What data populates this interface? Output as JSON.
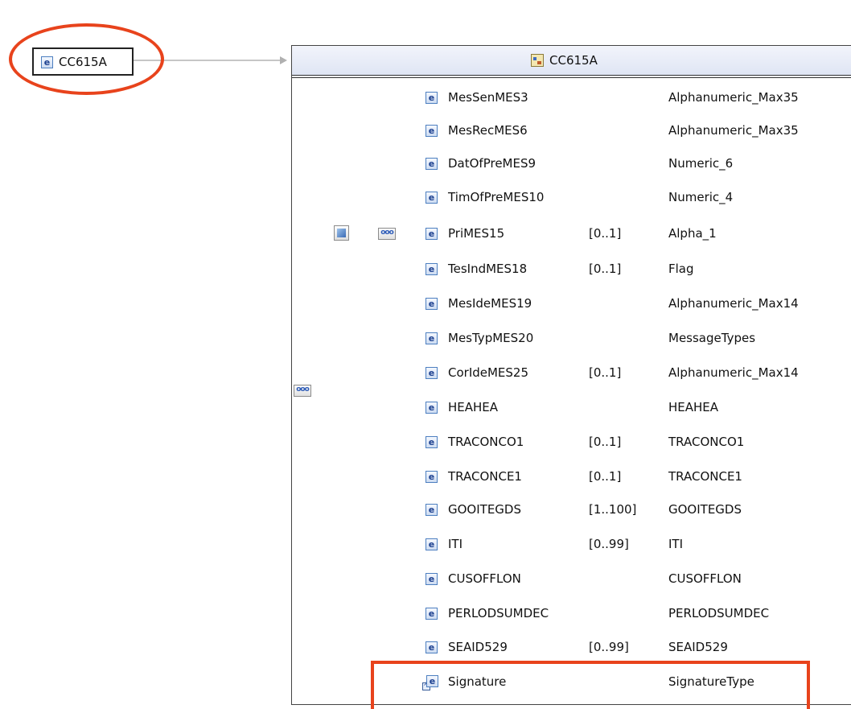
{
  "root": {
    "label": "CC615A",
    "icon": "element-icon"
  },
  "complex_type": {
    "title": "CC615A",
    "icon": "complex-type-icon"
  },
  "sequence_icon_text": "ooo",
  "header_elements": [
    {
      "name": "MesSenMES3",
      "cardinality": "",
      "type": "Alphanumeric_Max35"
    },
    {
      "name": "MesRecMES6",
      "cardinality": "",
      "type": "Alphanumeric_Max35"
    },
    {
      "name": "DatOfPreMES9",
      "cardinality": "",
      "type": "Numeric_6"
    },
    {
      "name": "TimOfPreMES10",
      "cardinality": "",
      "type": "Numeric_4"
    },
    {
      "name": "PriMES15",
      "cardinality": "[0..1]",
      "type": "Alpha_1"
    },
    {
      "name": "TesIndMES18",
      "cardinality": "[0..1]",
      "type": "Flag"
    },
    {
      "name": "MesIdeMES19",
      "cardinality": "",
      "type": "Alphanumeric_Max14"
    },
    {
      "name": "MesTypMES20",
      "cardinality": "",
      "type": "MessageTypes"
    },
    {
      "name": "CorIdeMES25",
      "cardinality": "[0..1]",
      "type": "Alphanumeric_Max14"
    }
  ],
  "body_elements": [
    {
      "name": "HEAHEA",
      "cardinality": "",
      "type": "HEAHEA"
    },
    {
      "name": "TRACONCO1",
      "cardinality": "[0..1]",
      "type": "TRACONCO1"
    },
    {
      "name": "TRACONCE1",
      "cardinality": "[0..1]",
      "type": "TRACONCE1"
    },
    {
      "name": "GOOITEGDS",
      "cardinality": "[1..100]",
      "type": "GOOITEGDS"
    },
    {
      "name": "ITI",
      "cardinality": "[0..99]",
      "type": "ITI"
    },
    {
      "name": "CUSOFFLON",
      "cardinality": "",
      "type": "CUSOFFLON"
    },
    {
      "name": "PERLODSUMDEC",
      "cardinality": "",
      "type": "PERLODSUMDEC"
    },
    {
      "name": "SEAID529",
      "cardinality": "[0..99]",
      "type": "SEAID529"
    }
  ],
  "signature": {
    "name": "Signature",
    "cardinality": "",
    "type": "SignatureType",
    "icon": "element-reference-icon"
  },
  "icon_letter": "e",
  "colors": {
    "highlight": "#e8431c",
    "line": "#8c8c8c",
    "header_bg": "#dfe5f4"
  }
}
